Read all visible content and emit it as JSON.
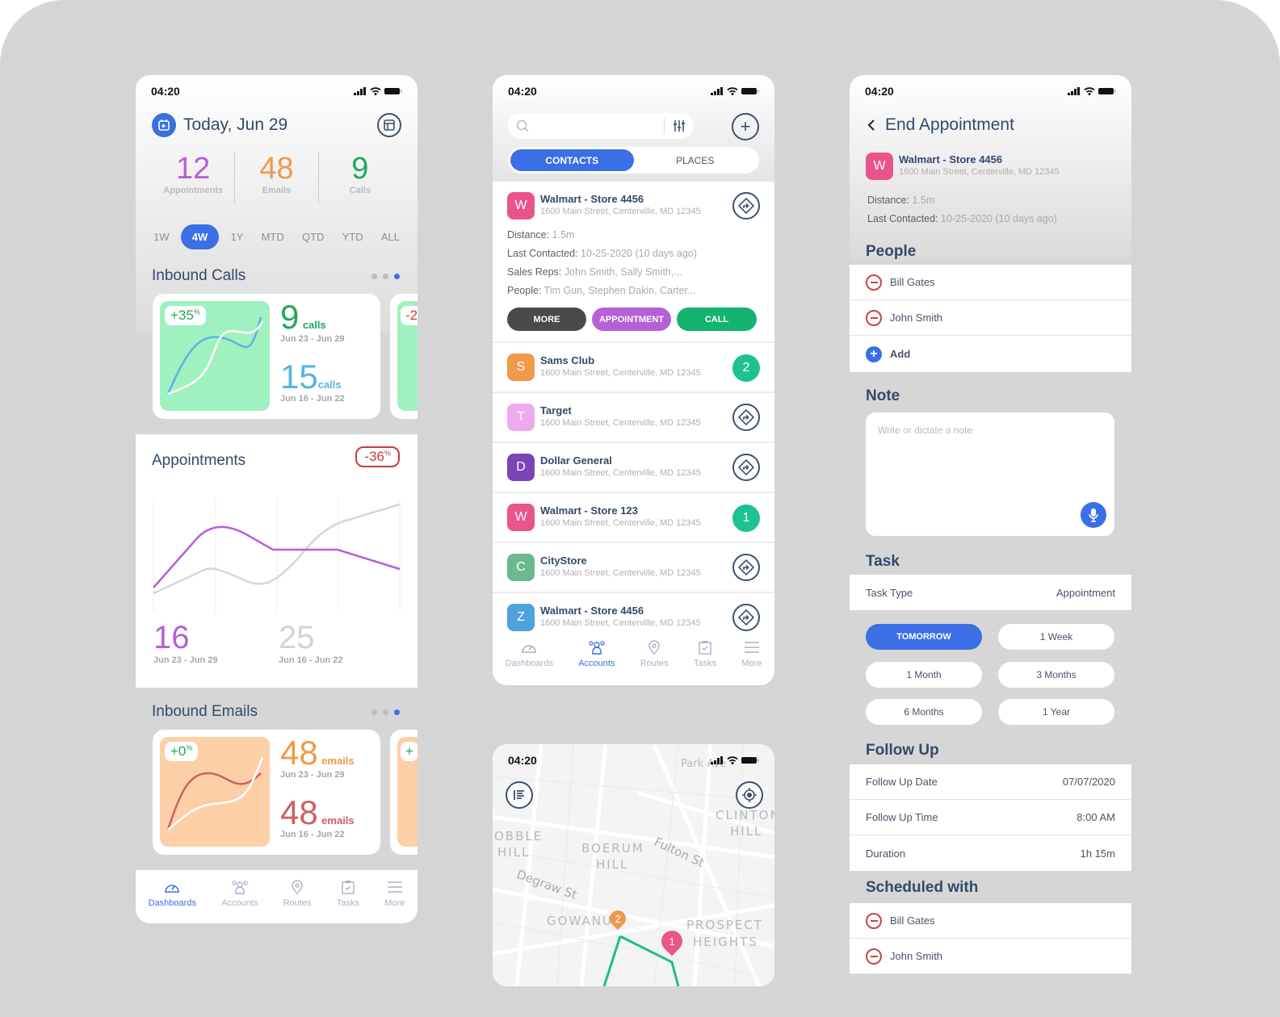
{
  "status_time": "04:20",
  "dashboard": {
    "title": "Today, Jun 29",
    "stats": [
      {
        "value": "12",
        "label": "Appointments",
        "color": "#b660d8"
      },
      {
        "value": "48",
        "label": "Emails",
        "color": "#ef9a4a"
      },
      {
        "value": "9",
        "label": "Calls",
        "color": "#22a65a"
      }
    ],
    "ranges": [
      "1W",
      "4W",
      "1Y",
      "MTD",
      "QTD",
      "YTD",
      "ALL"
    ],
    "active_range": "4W",
    "inbound_calls": {
      "title": "Inbound Calls",
      "change": "+35",
      "change_unit": "%",
      "current": {
        "value": "9",
        "unit": "calls",
        "range": "Jun 23 - Jun 29"
      },
      "previous": {
        "value": "15",
        "unit": "calls",
        "range": "Jun 16 - Jun 22"
      },
      "peek_change": "-2"
    },
    "appointments": {
      "title": "Appointments",
      "change": "-36",
      "change_unit": "%",
      "current": {
        "value": "16",
        "range": "Jun 23 - Jun 29"
      },
      "previous": {
        "value": "25",
        "range": "Jun 16 - Jun 22"
      }
    },
    "inbound_emails": {
      "title": "Inbound Emails",
      "change": "+0",
      "change_unit": "%",
      "current": {
        "value": "48",
        "unit": "emails",
        "range": "Jun 23 - Jun 29"
      },
      "previous": {
        "value": "48",
        "unit": "emails",
        "range": "Jun 16 - Jun 22"
      },
      "peek_change": "+"
    }
  },
  "tabs": [
    "Dashboards",
    "Accounts",
    "Routes",
    "Tasks",
    "More"
  ],
  "accounts": {
    "search_placeholder": "",
    "segments": [
      "CONTACTS",
      "PLACES"
    ],
    "expanded": {
      "initial": "W",
      "color": "#e9558a",
      "name": "Walmart - Store 4456",
      "address": "1600 Main Street, Centerville, MD 12345",
      "details": [
        {
          "label": "Distance:",
          "value": "1.5m"
        },
        {
          "label": "Last Contacted:",
          "value": "10-25-2020 (10 days ago)"
        },
        {
          "label": "Sales Reps:",
          "value": "John Smith, Sally Smith,..."
        },
        {
          "label": "People:",
          "value": "Tim Gun, Stephen Dakin, Carter..."
        }
      ],
      "actions": [
        {
          "label": "MORE",
          "color": "#4a4a4a"
        },
        {
          "label": "APPOINTMENT",
          "color": "#b660d8"
        },
        {
          "label": "CALL",
          "color": "#14b370"
        }
      ]
    },
    "rows": [
      {
        "initial": "S",
        "color": "#ef9a4a",
        "name": "Sams Club",
        "address": "1600 Main Street, Centerville, MD 12345",
        "count": "2"
      },
      {
        "initial": "T",
        "color": "#eeaaee",
        "name": "Target",
        "address": "1600 Main Street, Centerville, MD 12345",
        "count": null
      },
      {
        "initial": "D",
        "color": "#7a45b8",
        "name": "Dollar General",
        "address": "1600 Main Street, Centerville, MD 12345",
        "count": null
      },
      {
        "initial": "W",
        "color": "#e9558a",
        "name": "Walmart - Store 123",
        "address": "1600 Main Street, Centerville, MD 12345",
        "count": "1"
      },
      {
        "initial": "C",
        "color": "#6db88e",
        "name": "CityStore",
        "address": "1600 Main Street, Centerville, MD 12345",
        "count": null
      },
      {
        "initial": "Z",
        "color": "#4fa2dc",
        "name": "Walmart - Store 4456",
        "address": "1600 Main Street, Centerville, MD 12345",
        "count": null
      }
    ]
  },
  "map": {
    "labels": [
      "Park Ave",
      "CLINTON",
      "HILL",
      "OBBLE",
      "HILL",
      "BOERUM",
      "HILL",
      "Fulton St",
      "Degraw St",
      "GOWANUS",
      "PROSPECT",
      "HEIGHTS"
    ],
    "pins": [
      {
        "label": "2",
        "color": "#ef9a4a"
      },
      {
        "label": "1",
        "color": "#e9558a"
      }
    ]
  },
  "end_appointment": {
    "title": "End Appointment",
    "store": {
      "initial": "W",
      "name": "Walmart - Store 4456",
      "address": "1600 Main Street, Centerville, MD 12345"
    },
    "distance_label": "Distance:",
    "distance": "1.5m",
    "last_label": "Last Contacted:",
    "last": "10-25-2020 (10 days ago)",
    "people_title": "People",
    "people": [
      "Bill Gates",
      "John Smith"
    ],
    "add_label": "Add",
    "note_title": "Note",
    "note_placeholder": "Write or dictate a note",
    "task_title": "Task",
    "task_type_label": "Task Type",
    "task_type_value": "Appointment",
    "durations": [
      "TOMORROW",
      "1 Week",
      "1 Month",
      "3 Months",
      "6 Months",
      "1 Year"
    ],
    "active_duration": "TOMORROW",
    "followup_title": "Follow Up",
    "followup": [
      {
        "label": "Follow Up Date",
        "value": "07/07/2020"
      },
      {
        "label": "Follow Up Time",
        "value": "8:00 AM"
      },
      {
        "label": "Duration",
        "value": "1h 15m"
      }
    ],
    "scheduled_title": "Scheduled with",
    "scheduled": [
      "Bill Gates",
      "John Smith"
    ]
  }
}
